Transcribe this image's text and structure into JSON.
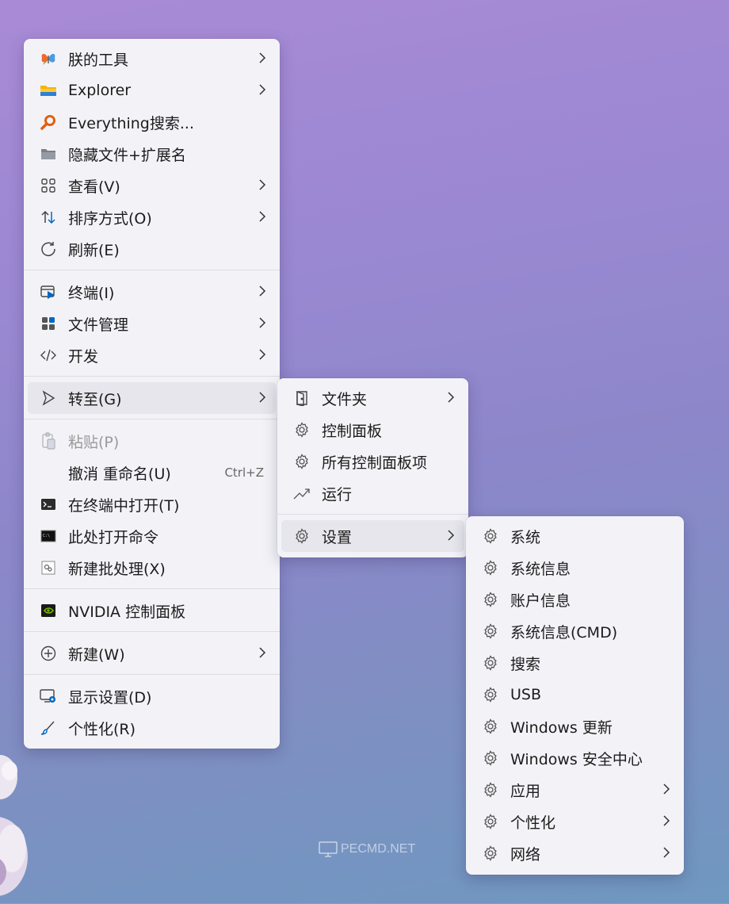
{
  "main_menu": {
    "items": [
      {
        "label": "朕的工具",
        "icon": "butterfly-icon",
        "submenu": true
      },
      {
        "label": "Explorer",
        "icon": "folder-icon",
        "submenu": true
      },
      {
        "label": "Everything搜索...",
        "icon": "magnifier-icon",
        "submenu": false
      },
      {
        "label": "隐藏文件+扩展名",
        "icon": "folder-gray-icon",
        "submenu": false
      },
      {
        "label": "查看(V)",
        "icon": "grid-view-icon",
        "submenu": true
      },
      {
        "label": "排序方式(O)",
        "icon": "sort-icon",
        "submenu": true
      },
      {
        "label": "刷新(E)",
        "icon": "refresh-icon",
        "submenu": false
      },
      {
        "label": "终端(I)",
        "icon": "terminal-icon",
        "submenu": true
      },
      {
        "label": "文件管理",
        "icon": "apps-icon",
        "submenu": true
      },
      {
        "label": "开发",
        "icon": "code-icon",
        "submenu": true
      },
      {
        "label": "转至(G)",
        "icon": "pointer-icon",
        "submenu": true
      },
      {
        "label": "粘贴(P)",
        "icon": "paste-icon",
        "submenu": false
      },
      {
        "label": "撤消 重命名(U)",
        "shortcut": "Ctrl+Z",
        "submenu": false
      },
      {
        "label": "在终端中打开(T)",
        "icon": "console-icon",
        "submenu": false
      },
      {
        "label": "此处打开命令",
        "icon": "cmd-icon",
        "submenu": false
      },
      {
        "label": "新建批处理(X)",
        "icon": "batch-icon",
        "submenu": false
      },
      {
        "label": "NVIDIA 控制面板",
        "icon": "nvidia-icon",
        "submenu": false
      },
      {
        "label": "新建(W)",
        "icon": "plus-circle-icon",
        "submenu": true
      },
      {
        "label": "显示设置(D)",
        "icon": "display-icon",
        "submenu": false
      },
      {
        "label": "个性化(R)",
        "icon": "brush-icon",
        "submenu": false
      }
    ]
  },
  "goto_menu": {
    "items": [
      {
        "label": "文件夹",
        "icon": "door-icon",
        "submenu": true
      },
      {
        "label": "控制面板",
        "icon": "gear-icon",
        "submenu": false
      },
      {
        "label": "所有控制面板项",
        "icon": "gear-icon",
        "submenu": false
      },
      {
        "label": "运行",
        "icon": "run-icon",
        "submenu": false
      },
      {
        "label": "设置",
        "icon": "gear-icon",
        "submenu": true
      }
    ]
  },
  "settings_menu": {
    "items": [
      {
        "label": "系统",
        "icon": "gear-icon",
        "submenu": false
      },
      {
        "label": "系统信息",
        "icon": "gear-icon",
        "submenu": false
      },
      {
        "label": "账户信息",
        "icon": "gear-icon",
        "submenu": false
      },
      {
        "label": "系统信息(CMD)",
        "icon": "gear-icon",
        "submenu": false
      },
      {
        "label": "搜索",
        "icon": "gear-icon",
        "submenu": false
      },
      {
        "label": "USB",
        "icon": "gear-icon",
        "submenu": false
      },
      {
        "label": "Windows 更新",
        "icon": "gear-icon",
        "submenu": false
      },
      {
        "label": "Windows 安全中心",
        "icon": "gear-icon",
        "submenu": false
      },
      {
        "label": "应用",
        "icon": "gear-icon",
        "submenu": true
      },
      {
        "label": "个性化",
        "icon": "gear-icon",
        "submenu": true
      },
      {
        "label": "网络",
        "icon": "gear-icon",
        "submenu": true
      }
    ]
  },
  "watermark": "PECMD.NET",
  "colors": {
    "accent": "#0067c0",
    "menu_bg": "#f3f3f7",
    "hover_bg": "#e6e6ec"
  }
}
